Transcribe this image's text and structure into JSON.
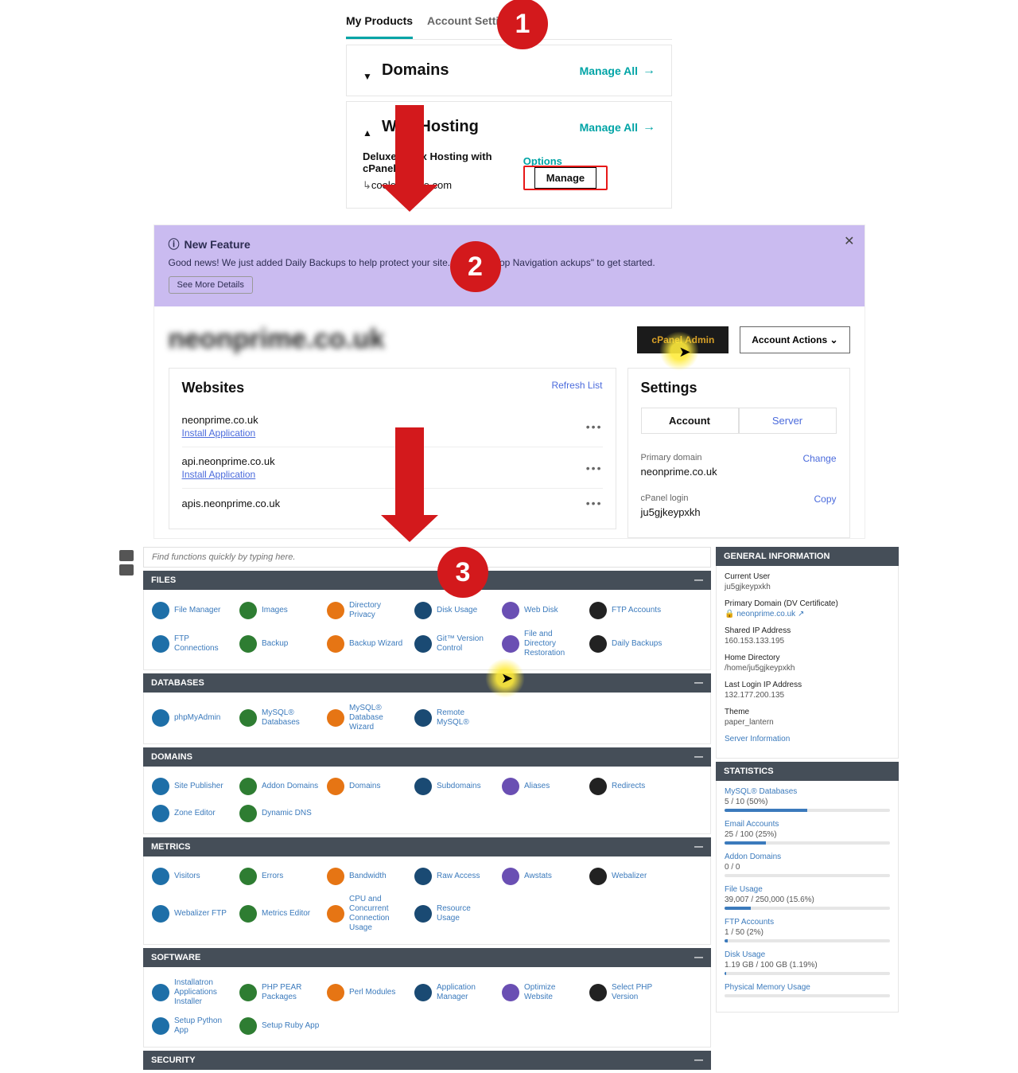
{
  "step1": {
    "tabs": {
      "products": "My Products",
      "settings": "Account Settings"
    },
    "domains": {
      "title": "Domains",
      "manage_all": "Manage All"
    },
    "hosting": {
      "title": "Web Hosting",
      "manage_all": "Manage All",
      "plan": "Deluxe Linux Hosting with cPanel",
      "domain": "coolexample.com",
      "options": "Options",
      "manage": "Manage"
    }
  },
  "step_badges": {
    "one": "1",
    "two": "2",
    "three": "3"
  },
  "step2": {
    "banner": {
      "title": "New Feature",
      "text": "Good news! We just added Daily Backups to help protect your site. Go to the Top Navigation                    ackups\" to get started.",
      "see_more": "See More Details"
    },
    "domain_title": "neonprime.co.uk",
    "cpanel_admin": "cPanel Admin",
    "account_actions": "Account Actions  ⌄",
    "websites": {
      "heading": "Websites",
      "refresh": "Refresh List",
      "install": "Install Application",
      "rows": [
        {
          "domain": "neonprime.co.uk",
          "install": true
        },
        {
          "domain": "api.neonprime.co.uk",
          "install": true
        },
        {
          "domain": "apis.neonprime.co.uk",
          "install": false
        }
      ]
    },
    "settings": {
      "heading": "Settings",
      "tab_account": "Account",
      "tab_server": "Server",
      "primary_lbl": "Primary domain",
      "primary_val": "neonprime.co.uk",
      "change": "Change",
      "login_lbl": "cPanel login",
      "login_val": "ju5gjkeypxkh",
      "copy": "Copy"
    }
  },
  "step3": {
    "search_placeholder": "Find functions quickly by typing here.",
    "sections": {
      "files": {
        "title": "FILES",
        "items": [
          "File Manager",
          "Images",
          "Directory Privacy",
          "Disk Usage",
          "Web Disk",
          "FTP Accounts",
          "FTP Connections",
          "Backup",
          "Backup Wizard",
          "Git™ Version Control",
          "File and Directory Restoration",
          "Daily Backups"
        ]
      },
      "databases": {
        "title": "DATABASES",
        "items": [
          "phpMyAdmin",
          "MySQL® Databases",
          "MySQL® Database Wizard",
          "Remote MySQL®"
        ]
      },
      "domains": {
        "title": "DOMAINS",
        "items": [
          "Site Publisher",
          "Addon Domains",
          "Domains",
          "Subdomains",
          "Aliases",
          "Redirects",
          "Zone Editor",
          "Dynamic DNS"
        ]
      },
      "metrics": {
        "title": "METRICS",
        "items": [
          "Visitors",
          "Errors",
          "Bandwidth",
          "Raw Access",
          "Awstats",
          "Webalizer",
          "Webalizer FTP",
          "Metrics Editor",
          "CPU and Concurrent Connection Usage",
          "Resource Usage"
        ]
      },
      "software": {
        "title": "SOFTWARE",
        "items": [
          "Installatron Applications Installer",
          "PHP PEAR Packages",
          "Perl Modules",
          "Application Manager",
          "Optimize Website",
          "Select PHP Version",
          "Setup Python App",
          "Setup Ruby App"
        ]
      },
      "security": {
        "title": "SECURITY",
        "items": []
      }
    },
    "general_info": {
      "title": "GENERAL INFORMATION",
      "rows": [
        {
          "lbl": "Current User",
          "val": "ju5gjkeypxkh",
          "link": false
        },
        {
          "lbl": "Primary Domain (DV Certificate)",
          "val": "🔒 neonprime.co.uk ↗",
          "link": true
        },
        {
          "lbl": "Shared IP Address",
          "val": "160.153.133.195",
          "link": false
        },
        {
          "lbl": "Home Directory",
          "val": "/home/ju5gjkeypxkh",
          "link": false
        },
        {
          "lbl": "Last Login IP Address",
          "val": "132.177.200.135",
          "link": false
        },
        {
          "lbl": "Theme",
          "val": "paper_lantern",
          "link": false
        }
      ],
      "server_info": "Server Information"
    },
    "statistics": {
      "title": "STATISTICS",
      "rows": [
        {
          "lbl": "MySQL® Databases",
          "val": "5 / 10   (50%)",
          "pct": 50
        },
        {
          "lbl": "Email Accounts",
          "val": "25 / 100   (25%)",
          "pct": 25
        },
        {
          "lbl": "Addon Domains",
          "val": "0 / 0",
          "pct": 0
        },
        {
          "lbl": "File Usage",
          "val": "39,007 / 250,000   (15.6%)",
          "pct": 16
        },
        {
          "lbl": "FTP Accounts",
          "val": "1 / 50   (2%)",
          "pct": 2
        },
        {
          "lbl": "Disk Usage",
          "val": "1.19 GB / 100 GB   (1.19%)",
          "pct": 1
        },
        {
          "lbl": "Physical Memory Usage",
          "val": "",
          "pct": 0
        }
      ]
    }
  }
}
